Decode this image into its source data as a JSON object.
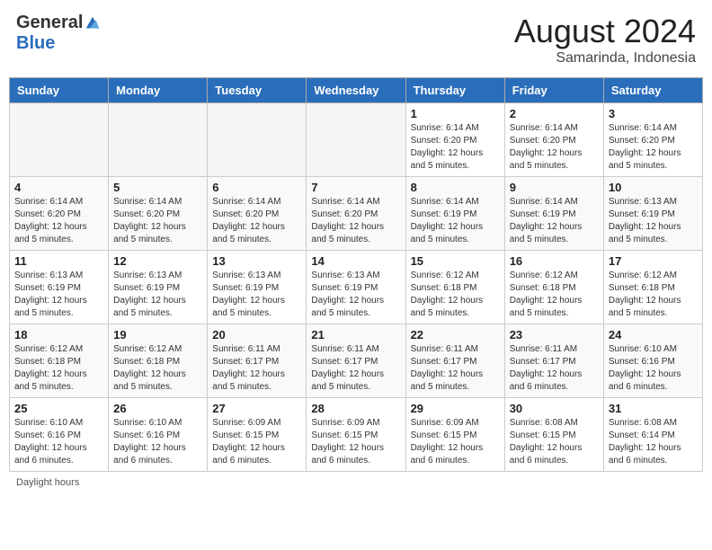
{
  "header": {
    "logo_general": "General",
    "logo_blue": "Blue",
    "month_year": "August 2024",
    "location": "Samarinda, Indonesia"
  },
  "weekdays": [
    "Sunday",
    "Monday",
    "Tuesday",
    "Wednesday",
    "Thursday",
    "Friday",
    "Saturday"
  ],
  "weeks": [
    [
      {
        "day": "",
        "info": ""
      },
      {
        "day": "",
        "info": ""
      },
      {
        "day": "",
        "info": ""
      },
      {
        "day": "",
        "info": ""
      },
      {
        "day": "1",
        "info": "Sunrise: 6:14 AM\nSunset: 6:20 PM\nDaylight: 12 hours and 5 minutes."
      },
      {
        "day": "2",
        "info": "Sunrise: 6:14 AM\nSunset: 6:20 PM\nDaylight: 12 hours and 5 minutes."
      },
      {
        "day": "3",
        "info": "Sunrise: 6:14 AM\nSunset: 6:20 PM\nDaylight: 12 hours and 5 minutes."
      }
    ],
    [
      {
        "day": "4",
        "info": "Sunrise: 6:14 AM\nSunset: 6:20 PM\nDaylight: 12 hours and 5 minutes."
      },
      {
        "day": "5",
        "info": "Sunrise: 6:14 AM\nSunset: 6:20 PM\nDaylight: 12 hours and 5 minutes."
      },
      {
        "day": "6",
        "info": "Sunrise: 6:14 AM\nSunset: 6:20 PM\nDaylight: 12 hours and 5 minutes."
      },
      {
        "day": "7",
        "info": "Sunrise: 6:14 AM\nSunset: 6:20 PM\nDaylight: 12 hours and 5 minutes."
      },
      {
        "day": "8",
        "info": "Sunrise: 6:14 AM\nSunset: 6:19 PM\nDaylight: 12 hours and 5 minutes."
      },
      {
        "day": "9",
        "info": "Sunrise: 6:14 AM\nSunset: 6:19 PM\nDaylight: 12 hours and 5 minutes."
      },
      {
        "day": "10",
        "info": "Sunrise: 6:13 AM\nSunset: 6:19 PM\nDaylight: 12 hours and 5 minutes."
      }
    ],
    [
      {
        "day": "11",
        "info": "Sunrise: 6:13 AM\nSunset: 6:19 PM\nDaylight: 12 hours and 5 minutes."
      },
      {
        "day": "12",
        "info": "Sunrise: 6:13 AM\nSunset: 6:19 PM\nDaylight: 12 hours and 5 minutes."
      },
      {
        "day": "13",
        "info": "Sunrise: 6:13 AM\nSunset: 6:19 PM\nDaylight: 12 hours and 5 minutes."
      },
      {
        "day": "14",
        "info": "Sunrise: 6:13 AM\nSunset: 6:19 PM\nDaylight: 12 hours and 5 minutes."
      },
      {
        "day": "15",
        "info": "Sunrise: 6:12 AM\nSunset: 6:18 PM\nDaylight: 12 hours and 5 minutes."
      },
      {
        "day": "16",
        "info": "Sunrise: 6:12 AM\nSunset: 6:18 PM\nDaylight: 12 hours and 5 minutes."
      },
      {
        "day": "17",
        "info": "Sunrise: 6:12 AM\nSunset: 6:18 PM\nDaylight: 12 hours and 5 minutes."
      }
    ],
    [
      {
        "day": "18",
        "info": "Sunrise: 6:12 AM\nSunset: 6:18 PM\nDaylight: 12 hours and 5 minutes."
      },
      {
        "day": "19",
        "info": "Sunrise: 6:12 AM\nSunset: 6:18 PM\nDaylight: 12 hours and 5 minutes."
      },
      {
        "day": "20",
        "info": "Sunrise: 6:11 AM\nSunset: 6:17 PM\nDaylight: 12 hours and 5 minutes."
      },
      {
        "day": "21",
        "info": "Sunrise: 6:11 AM\nSunset: 6:17 PM\nDaylight: 12 hours and 5 minutes."
      },
      {
        "day": "22",
        "info": "Sunrise: 6:11 AM\nSunset: 6:17 PM\nDaylight: 12 hours and 5 minutes."
      },
      {
        "day": "23",
        "info": "Sunrise: 6:11 AM\nSunset: 6:17 PM\nDaylight: 12 hours and 6 minutes."
      },
      {
        "day": "24",
        "info": "Sunrise: 6:10 AM\nSunset: 6:16 PM\nDaylight: 12 hours and 6 minutes."
      }
    ],
    [
      {
        "day": "25",
        "info": "Sunrise: 6:10 AM\nSunset: 6:16 PM\nDaylight: 12 hours and 6 minutes."
      },
      {
        "day": "26",
        "info": "Sunrise: 6:10 AM\nSunset: 6:16 PM\nDaylight: 12 hours and 6 minutes."
      },
      {
        "day": "27",
        "info": "Sunrise: 6:09 AM\nSunset: 6:15 PM\nDaylight: 12 hours and 6 minutes."
      },
      {
        "day": "28",
        "info": "Sunrise: 6:09 AM\nSunset: 6:15 PM\nDaylight: 12 hours and 6 minutes."
      },
      {
        "day": "29",
        "info": "Sunrise: 6:09 AM\nSunset: 6:15 PM\nDaylight: 12 hours and 6 minutes."
      },
      {
        "day": "30",
        "info": "Sunrise: 6:08 AM\nSunset: 6:15 PM\nDaylight: 12 hours and 6 minutes."
      },
      {
        "day": "31",
        "info": "Sunrise: 6:08 AM\nSunset: 6:14 PM\nDaylight: 12 hours and 6 minutes."
      }
    ]
  ],
  "footer": {
    "daylight_label": "Daylight hours"
  }
}
